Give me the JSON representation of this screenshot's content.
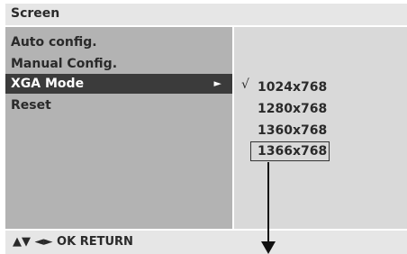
{
  "window": {
    "title": "Screen"
  },
  "menu": {
    "items": [
      {
        "label": "Auto config."
      },
      {
        "label": "Manual Config."
      },
      {
        "label": "XGA Mode",
        "arrow": "►"
      },
      {
        "label": "Reset"
      }
    ]
  },
  "submenu": {
    "check_mark": "√",
    "options": [
      {
        "label": "1024x768"
      },
      {
        "label": "1280x768"
      },
      {
        "label": "1360x768"
      },
      {
        "label": "1366x768"
      }
    ]
  },
  "hint": {
    "text": "▲▼  ◄►  OK  RETURN"
  },
  "colors": {
    "panel_left": "#b3b3b3",
    "panel_right": "#d9d9d9",
    "bars": "#e6e6e6",
    "selected_bg": "#3b3b3b",
    "selected_fg": "#ffffff"
  }
}
